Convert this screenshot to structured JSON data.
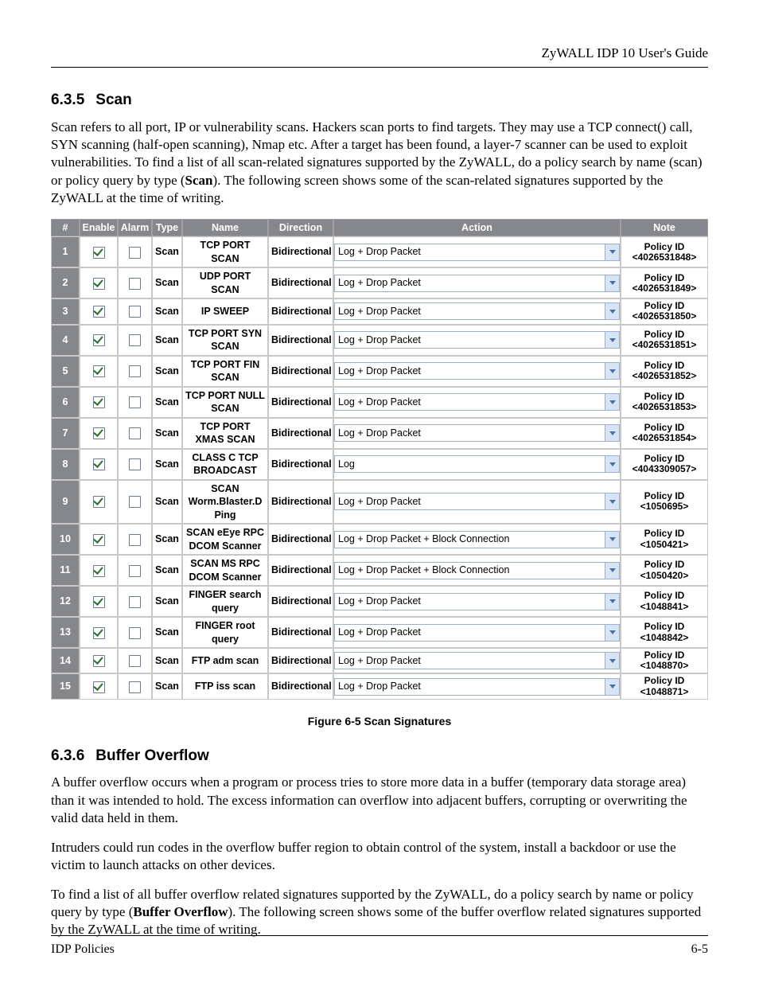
{
  "doc": {
    "header_title": "ZyWALL IDP 10 User's Guide",
    "footer_left": "IDP Policies",
    "footer_right": "6-5"
  },
  "section_scan": {
    "num": "6.3.5",
    "title": "Scan",
    "para": "Scan refers to all port, IP or vulnerability scans. Hackers scan ports to find targets. They may use a TCP connect() call, SYN scanning (half-open scanning), Nmap etc. After a target has been found, a layer-7 scanner can be used to exploit vulnerabilities. To find a list of all scan-related signatures supported by the ZyWALL, do a policy search by name (scan) or policy query by type (",
    "para_bold": "Scan",
    "para_tail": "). The following screen shows some of the scan-related signatures supported by the ZyWALL at the time of writing."
  },
  "table": {
    "headers": {
      "num": "#",
      "enable": "Enable",
      "alarm": "Alarm",
      "type": "Type",
      "name": "Name",
      "direction": "Direction",
      "action": "Action",
      "note": "Note"
    },
    "note_label": "Policy ID",
    "rows": [
      {
        "n": "1",
        "enable": true,
        "alarm": false,
        "type": "Scan",
        "name": "TCP PORT SCAN",
        "dir": "Bidirectional",
        "action": "Log + Drop Packet",
        "pid": "<4026531848>"
      },
      {
        "n": "2",
        "enable": true,
        "alarm": false,
        "type": "Scan",
        "name": "UDP PORT SCAN",
        "dir": "Bidirectional",
        "action": "Log + Drop Packet",
        "pid": "<4026531849>"
      },
      {
        "n": "3",
        "enable": true,
        "alarm": false,
        "type": "Scan",
        "name": "IP SWEEP",
        "dir": "Bidirectional",
        "action": "Log + Drop Packet",
        "pid": "<4026531850>"
      },
      {
        "n": "4",
        "enable": true,
        "alarm": false,
        "type": "Scan",
        "name": "TCP PORT SYN SCAN",
        "dir": "Bidirectional",
        "action": "Log + Drop Packet",
        "pid": "<4026531851>"
      },
      {
        "n": "5",
        "enable": true,
        "alarm": false,
        "type": "Scan",
        "name": "TCP PORT FIN SCAN",
        "dir": "Bidirectional",
        "action": "Log + Drop Packet",
        "pid": "<4026531852>"
      },
      {
        "n": "6",
        "enable": true,
        "alarm": false,
        "type": "Scan",
        "name": "TCP PORT NULL SCAN",
        "dir": "Bidirectional",
        "action": "Log + Drop Packet",
        "pid": "<4026531853>"
      },
      {
        "n": "7",
        "enable": true,
        "alarm": false,
        "type": "Scan",
        "name": "TCP PORT XMAS SCAN",
        "dir": "Bidirectional",
        "action": "Log + Drop Packet",
        "pid": "<4026531854>"
      },
      {
        "n": "8",
        "enable": true,
        "alarm": false,
        "type": "Scan",
        "name": "CLASS C TCP BROADCAST",
        "dir": "Bidirectional",
        "action": "Log",
        "pid": "<4043309057>"
      },
      {
        "n": "9",
        "enable": true,
        "alarm": false,
        "type": "Scan",
        "name": "SCAN Worm.Blaster.D Ping",
        "dir": "Bidirectional",
        "action": "Log + Drop Packet",
        "pid": "<1050695>"
      },
      {
        "n": "10",
        "enable": true,
        "alarm": false,
        "type": "Scan",
        "name": "SCAN eEye RPC DCOM Scanner",
        "dir": "Bidirectional",
        "action": "Log + Drop Packet + Block Connection",
        "pid": "<1050421>"
      },
      {
        "n": "11",
        "enable": true,
        "alarm": false,
        "type": "Scan",
        "name": "SCAN MS RPC DCOM Scanner",
        "dir": "Bidirectional",
        "action": "Log + Drop Packet + Block Connection",
        "pid": "<1050420>"
      },
      {
        "n": "12",
        "enable": true,
        "alarm": false,
        "type": "Scan",
        "name": "FINGER search query",
        "dir": "Bidirectional",
        "action": "Log + Drop Packet",
        "pid": "<1048841>"
      },
      {
        "n": "13",
        "enable": true,
        "alarm": false,
        "type": "Scan",
        "name": "FINGER root query",
        "dir": "Bidirectional",
        "action": "Log + Drop Packet",
        "pid": "<1048842>"
      },
      {
        "n": "14",
        "enable": true,
        "alarm": false,
        "type": "Scan",
        "name": "FTP adm scan",
        "dir": "Bidirectional",
        "action": "Log + Drop Packet",
        "pid": "<1048870>"
      },
      {
        "n": "15",
        "enable": true,
        "alarm": false,
        "type": "Scan",
        "name": "FTP iss scan",
        "dir": "Bidirectional",
        "action": "Log + Drop Packet",
        "pid": "<1048871>"
      }
    ]
  },
  "caption": "Figure 6-5 Scan Signatures",
  "section_overflow": {
    "num": "6.3.6",
    "title": "Buffer Overflow",
    "p1": "A buffer overflow occurs when a program or process tries to store more data in a buffer (temporary data storage area) than it was intended to hold. The excess information can overflow into adjacent buffers, corrupting or overwriting the valid data held in them.",
    "p2": "Intruders could run codes in the overflow buffer region to obtain control of the system, install a backdoor or use the victim to launch attacks on other devices.",
    "p3a": "To find a list of all buffer overflow related signatures supported by the ZyWALL, do a policy search by name or policy query by type (",
    "p3_bold": "Buffer Overflow",
    "p3b": "). The following screen shows some of the buffer overflow related signatures supported by the ZyWALL at the time of writing."
  }
}
